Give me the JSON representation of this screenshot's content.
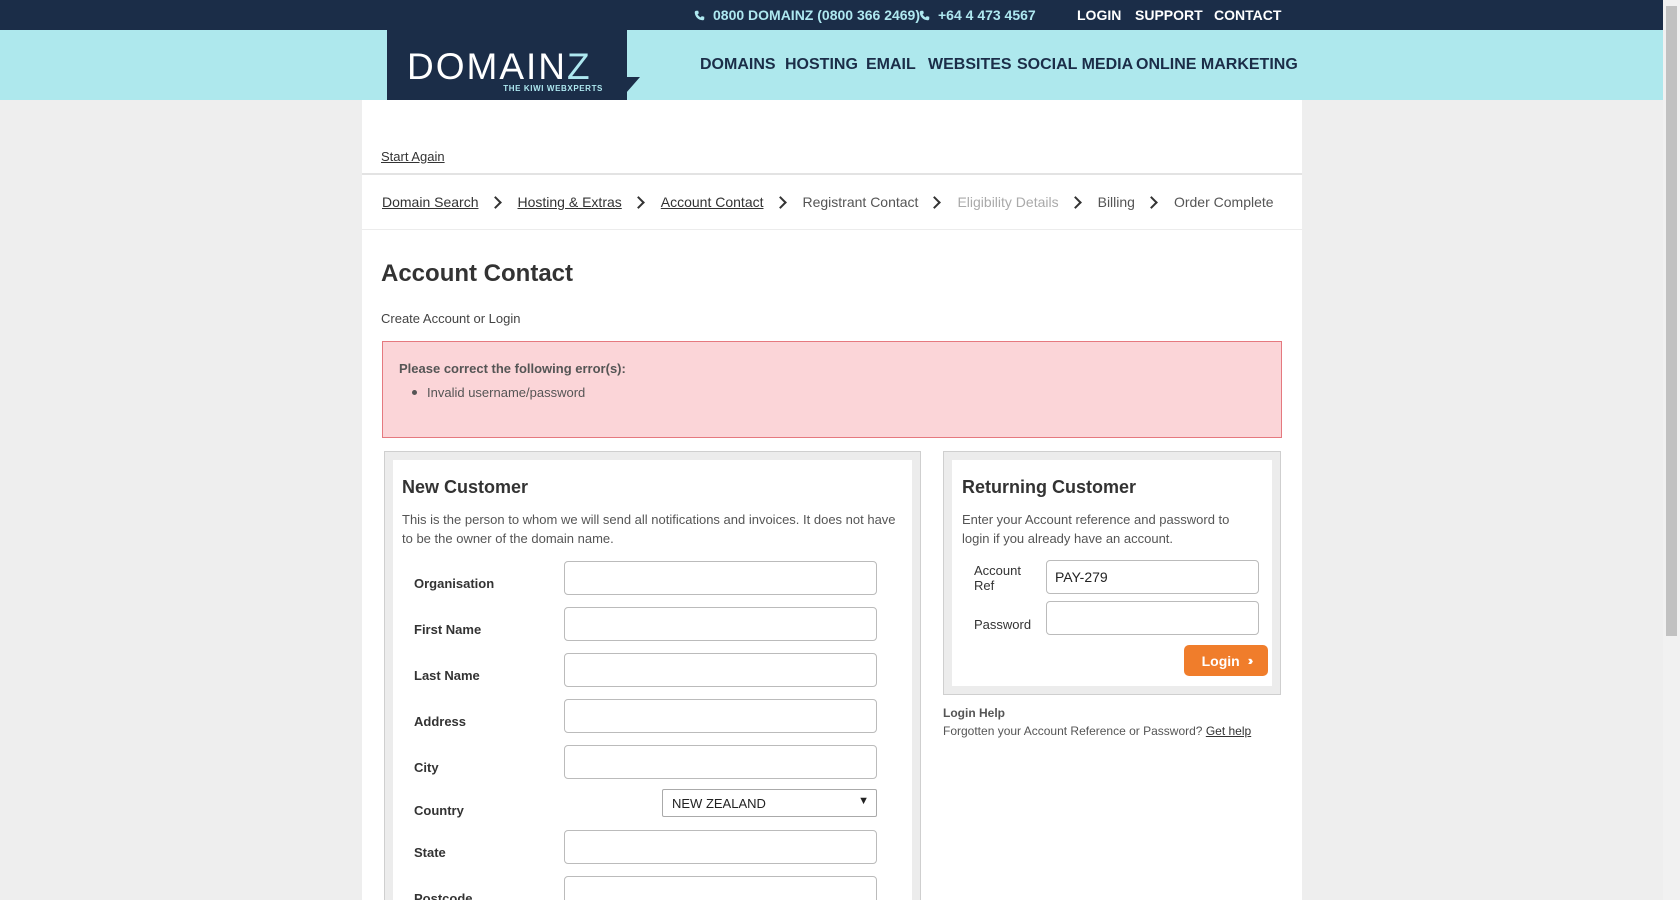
{
  "topbar": {
    "phone1": "0800 DOMAINZ (0800 366 2469)",
    "phone2": "+64 4 473 4567",
    "links": [
      "LOGIN",
      "SUPPORT",
      "CONTACT"
    ]
  },
  "logo": {
    "word_a": "DOMAIN",
    "word_b": "Z",
    "tagline": "THE KIWI WEBXPERTS"
  },
  "nav": [
    "DOMAINS",
    "HOSTING",
    "EMAIL",
    "WEBSITES",
    "SOCIAL MEDIA",
    "ONLINE MARKETING"
  ],
  "start_again": "Start Again",
  "breadcrumbs": [
    {
      "label": "Domain Search",
      "state": "link"
    },
    {
      "label": "Hosting & Extras",
      "state": "link"
    },
    {
      "label": "Account Contact",
      "state": "link"
    },
    {
      "label": "Registrant Contact",
      "state": "normal"
    },
    {
      "label": "Eligibility Details",
      "state": "disabled"
    },
    {
      "label": "Billing",
      "state": "normal"
    },
    {
      "label": "Order Complete",
      "state": "normal"
    }
  ],
  "page_title": "Account Contact",
  "subtitle": "Create Account or Login",
  "error": {
    "title": "Please correct the following error(s):",
    "items": [
      "Invalid username/password"
    ]
  },
  "new_customer": {
    "heading": "New Customer",
    "desc_line1": "This is the person to whom we will send all notifications and invoices. It does not have",
    "desc_line2": "to be the owner of the domain name.",
    "fields": {
      "organisation": {
        "label": "Organisation",
        "value": ""
      },
      "first_name": {
        "label": "First Name",
        "value": ""
      },
      "last_name": {
        "label": "Last Name",
        "value": ""
      },
      "address": {
        "label": "Address",
        "value": ""
      },
      "city": {
        "label": "City",
        "value": ""
      },
      "country": {
        "label": "Country",
        "value": "NEW ZEALAND"
      },
      "state": {
        "label": "State",
        "value": ""
      },
      "postcode": {
        "label": "Postcode",
        "value": ""
      }
    }
  },
  "returning_customer": {
    "heading": "Returning Customer",
    "desc_line1": "Enter your Account reference and password to",
    "desc_line2": "login if you already have an account.",
    "account_ref_label_1": "Account",
    "account_ref_label_2": "Ref",
    "account_ref_value": "PAY-279",
    "password_label": "Password",
    "password_value": "",
    "login_button": "Login"
  },
  "login_help": {
    "title": "Login Help",
    "text": "Forgotten your Account Reference or Password?",
    "link": "Get help"
  },
  "colors": {
    "topbar": "#1b2d48",
    "navband": "#aee8ed",
    "accent": "#f07d2b",
    "error_bg": "#fbd5d8"
  }
}
